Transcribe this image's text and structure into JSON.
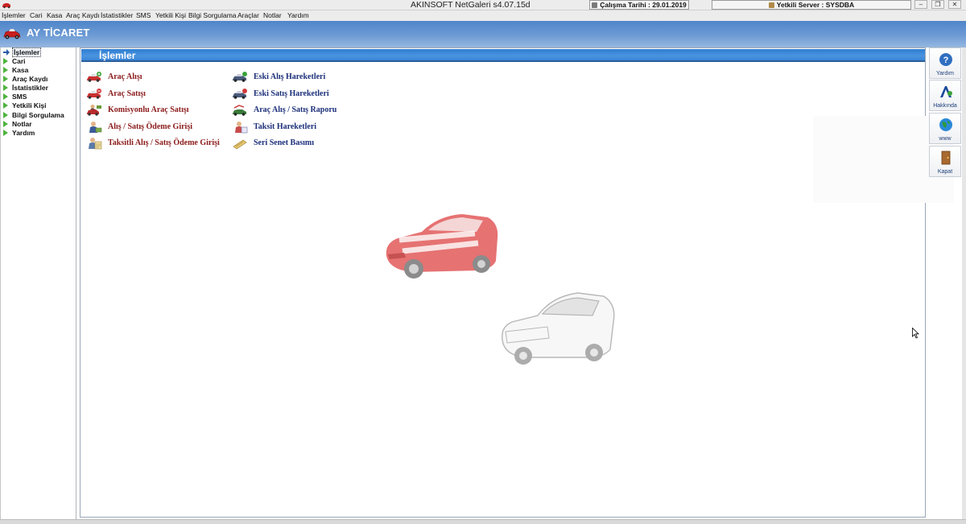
{
  "window": {
    "title": "AKINSOFT NetGaleri s4.07.15d",
    "work_date": "Çalışma Tarihi : 29.01.2019",
    "server": "Yetkili Server : SYSDBA"
  },
  "menu": [
    "İşlemler",
    "Cari",
    "Kasa",
    "Araç Kaydı",
    "İstatistikler",
    "SMS",
    "Yetkili Kişi",
    "Bilgi Sorgulama",
    "Araçlar",
    "Notlar",
    "Yardım"
  ],
  "banner": {
    "title": "AY TİCARET"
  },
  "tree": {
    "items": [
      "İşlemler",
      "Cari",
      "Kasa",
      "Araç Kaydı",
      "İstatistikler",
      "SMS",
      "Yetkili Kişi",
      "Bilgi Sorgulama",
      "Notlar",
      "Yardım"
    ],
    "selected": "İşlemler"
  },
  "panel": {
    "title": "İşlemler",
    "left_ops": [
      {
        "label": "Araç Alışı",
        "icon": "car-buy-icon"
      },
      {
        "label": "Araç Satışı",
        "icon": "car-sell-icon"
      },
      {
        "label": "Komisyonlu Araç Satışı",
        "icon": "commission-sale-icon"
      },
      {
        "label": "Alış / Satış Ödeme Girişi",
        "icon": "payment-entry-icon"
      },
      {
        "label": "Taksitli Alış / Satış Ödeme Girişi",
        "icon": "installment-payment-icon"
      }
    ],
    "right_ops": [
      {
        "label": "Eski Alış Hareketleri",
        "icon": "old-purchase-icon"
      },
      {
        "label": "Eski Satış Hareketleri",
        "icon": "old-sales-icon"
      },
      {
        "label": "Araç Alış / Satış Raporu",
        "icon": "report-icon"
      },
      {
        "label": "Taksit Hareketleri",
        "icon": "installment-movements-icon"
      },
      {
        "label": "Seri Senet Basımı",
        "icon": "promissory-note-icon"
      }
    ]
  },
  "toolbar": {
    "help": "Yardım",
    "about": "Hakkında",
    "web": "www",
    "close": "Kapat"
  },
  "colors": {
    "banner": "#4f85c9",
    "panel_header": "#2f7fd2",
    "op_red": "#8b1a1a",
    "op_blue": "#1c2f7a"
  }
}
